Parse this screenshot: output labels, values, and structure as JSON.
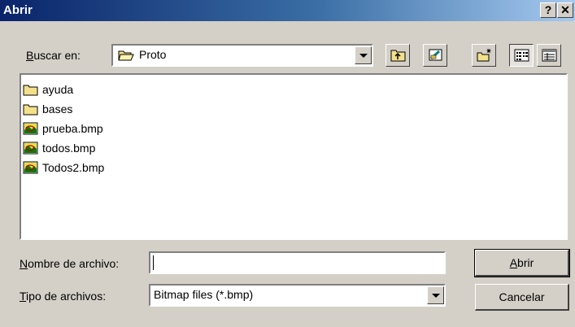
{
  "window": {
    "title": "Abrir",
    "help_button": "?",
    "close_button": "✕"
  },
  "lookin": {
    "label_prefix": "",
    "label_mnemonic": "B",
    "label_rest": "uscar en:",
    "value": "Proto"
  },
  "toolbar": {
    "buttons": [
      "up-folder",
      "desktop",
      "new-folder",
      "list-view",
      "details-view"
    ]
  },
  "files": [
    {
      "name": "ayuda",
      "type": "folder"
    },
    {
      "name": "bases",
      "type": "folder"
    },
    {
      "name": "prueba.bmp",
      "type": "bmp"
    },
    {
      "name": "todos.bmp",
      "type": "bmp"
    },
    {
      "name": "Todos2.bmp",
      "type": "bmp"
    }
  ],
  "filename": {
    "label_mnemonic": "N",
    "label_rest": "ombre de archivo:",
    "value": ""
  },
  "filetype": {
    "label_mnemonic": "T",
    "label_rest": "ipo de archivos:",
    "value": "Bitmap files (*.bmp)"
  },
  "buttons": {
    "open_mnemonic": "A",
    "open_rest": "brir",
    "cancel": "Cancelar"
  }
}
